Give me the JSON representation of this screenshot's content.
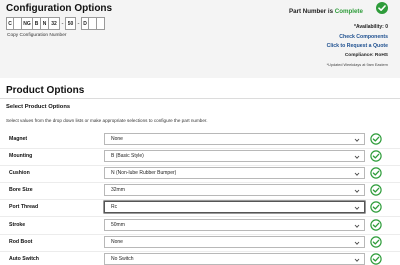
{
  "config": {
    "title": "Configuration Options",
    "segments": [
      "C",
      "",
      "NG",
      "B",
      "N",
      "32",
      "-",
      "50",
      "-",
      "D",
      "",
      ""
    ],
    "copy_label": "Copy Configuration Number"
  },
  "status": {
    "prefix": "Part Number is ",
    "state": "Complete",
    "availability": "*Availability: 0",
    "check_components": "Check Components",
    "request_quote": "Click to Request a Quote",
    "compliance": "Compliance: RoHS",
    "updated": "*Updated Weekdays at 9am Eastern",
    "accent": "#2e9c3a",
    "link_color": "#1d4f8f"
  },
  "product": {
    "title": "Product Options",
    "subtitle": "Select Product Options",
    "help": "Select values from the drop down lists or make appropriate selections to configure the part number."
  },
  "options": [
    {
      "label": "Magnet",
      "value": "None"
    },
    {
      "label": "Mounting",
      "value": "B (Basic Style)"
    },
    {
      "label": "Cushion",
      "value": "N (Non-lube Rubber Bumper)"
    },
    {
      "label": "Bore Size",
      "value": "32mm"
    },
    {
      "label": "Port Thread",
      "value": "Rc"
    },
    {
      "label": "Stroke",
      "value": "50mm"
    },
    {
      "label": "Rod Boot",
      "value": "None"
    },
    {
      "label": "Auto Switch",
      "value": "No Switch"
    }
  ]
}
